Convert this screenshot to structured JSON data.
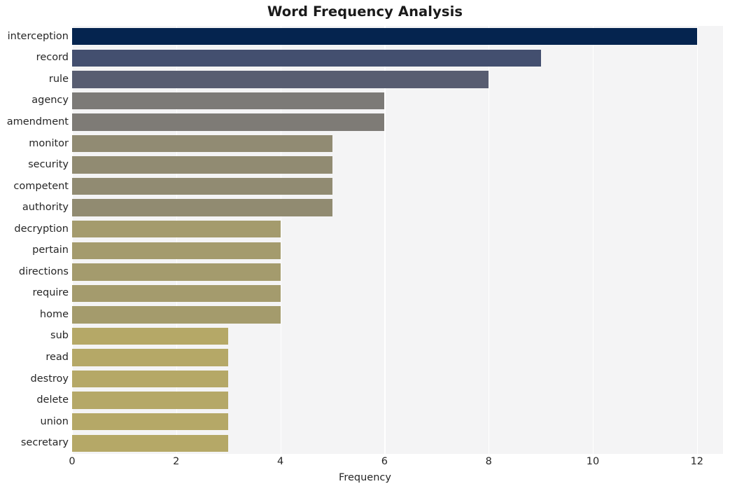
{
  "chart_data": {
    "type": "bar",
    "orientation": "horizontal",
    "title": "Word Frequency Analysis",
    "xlabel": "Frequency",
    "ylabel": "",
    "xlim": [
      0,
      12.5
    ],
    "xticks": [
      0,
      2,
      4,
      6,
      8,
      10,
      12
    ],
    "xtick_labels": [
      "0",
      "2",
      "4",
      "6",
      "8",
      "10",
      "12"
    ],
    "grid": true,
    "grid_axis": "x",
    "legend": null,
    "categories": [
      "interception",
      "record",
      "rule",
      "agency",
      "amendment",
      "monitor",
      "security",
      "competent",
      "authority",
      "decryption",
      "pertain",
      "directions",
      "require",
      "home",
      "sub",
      "read",
      "destroy",
      "delete",
      "union",
      "secretary"
    ],
    "values": [
      12,
      9,
      8,
      6,
      6,
      5,
      5,
      5,
      5,
      4,
      4,
      4,
      4,
      4,
      3,
      3,
      3,
      3,
      3,
      3
    ],
    "bar_colors": [
      "#05244f",
      "#434f6f",
      "#585d71",
      "#7c7a77",
      "#7e7b76",
      "#918b73",
      "#918b72",
      "#918b72",
      "#918b71",
      "#a49b6d",
      "#a49b6d",
      "#a49b6d",
      "#a49b6d",
      "#a49b6c",
      "#b5a867",
      "#b5a867",
      "#b5a867",
      "#b5a867",
      "#b5a867",
      "#b5a867"
    ],
    "plot_background": "#f4f4f5",
    "gridline_color": "#ffffff",
    "figure_background": "#ffffff",
    "text_color": "#262626",
    "title_color": "#1a1a1a"
  }
}
